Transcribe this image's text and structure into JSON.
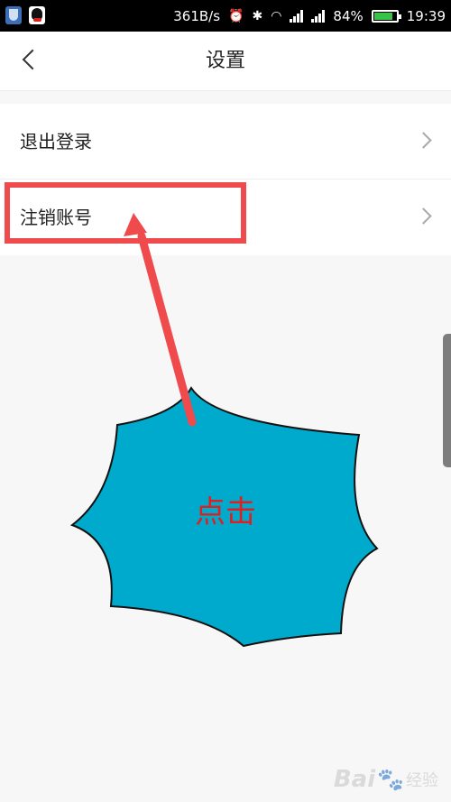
{
  "status_bar": {
    "net_speed": "361B/s",
    "battery_percent": "84%",
    "battery_level": 0.84,
    "time": "19:39",
    "icons": [
      "shield-app-icon",
      "qq-app-icon",
      "alarm-icon",
      "bluetooth-icon",
      "wifi-icon",
      "signal-icon",
      "battery-icon"
    ]
  },
  "header": {
    "back_icon": "chevron-left-icon",
    "title": "设置"
  },
  "settings_list": [
    {
      "label": "退出登录",
      "icon": "chevron-right-icon"
    },
    {
      "label": "注销账号",
      "icon": "chevron-right-icon"
    }
  ],
  "annotation": {
    "burst_text": "点击",
    "accent_color": "#ef4a4c",
    "burst_fill": "#00aacc",
    "burst_text_color": "#e02020"
  },
  "watermark": {
    "logo_text": "Bai",
    "sub_text": "经验"
  }
}
